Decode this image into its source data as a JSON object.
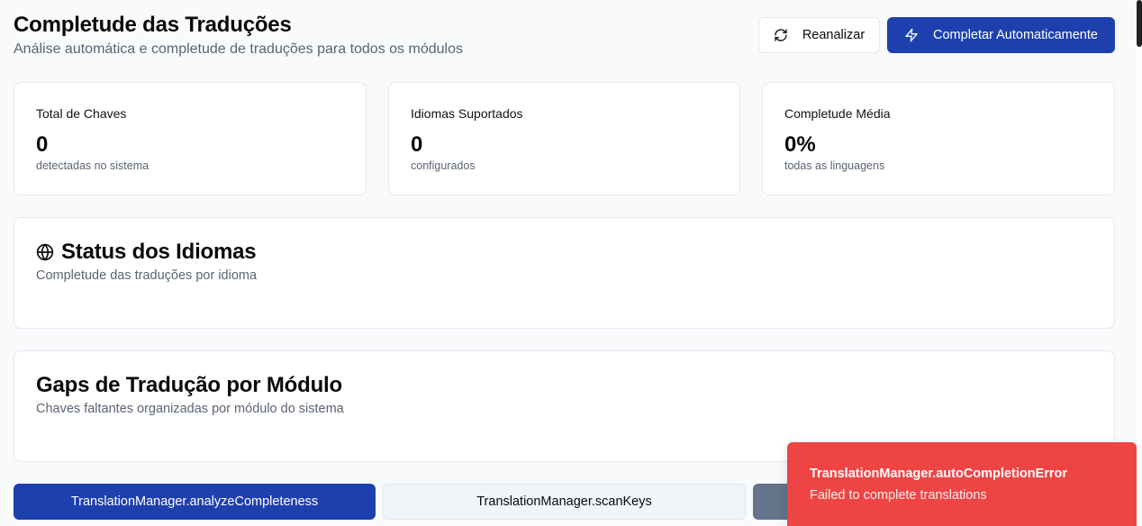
{
  "header": {
    "title": "Completude das Traduções",
    "subtitle": "Análise automática e completude de traduções para todos os módulos",
    "reanalyze_label": "Reanalizar",
    "autocomplete_label": "Completar Automaticamente"
  },
  "stats": [
    {
      "label": "Total de Chaves",
      "value": "0",
      "sub": "detectadas no sistema"
    },
    {
      "label": "Idiomas Suportados",
      "value": "0",
      "sub": "configurados"
    },
    {
      "label": "Completude Média",
      "value": "0%",
      "sub": "todas as linguagens"
    }
  ],
  "languages_section": {
    "title": "Status dos Idiomas",
    "subtitle": "Completude das traduções por idioma",
    "icon": "globe-icon"
  },
  "gaps_section": {
    "title": "Gaps de Tradução por Módulo",
    "subtitle": "Chaves faltantes organizadas por módulo do sistema"
  },
  "bottom_actions": [
    {
      "label": "TranslationManager.analyzeCompleteness"
    },
    {
      "label": "TranslationManager.scanKeys"
    },
    {
      "label": ""
    }
  ],
  "toast": {
    "title": "TranslationManager.autoCompletionError",
    "description": "Failed to complete translations"
  },
  "colors": {
    "primary": "#1e40af",
    "danger": "#ef4444",
    "muted": "#64748b"
  }
}
